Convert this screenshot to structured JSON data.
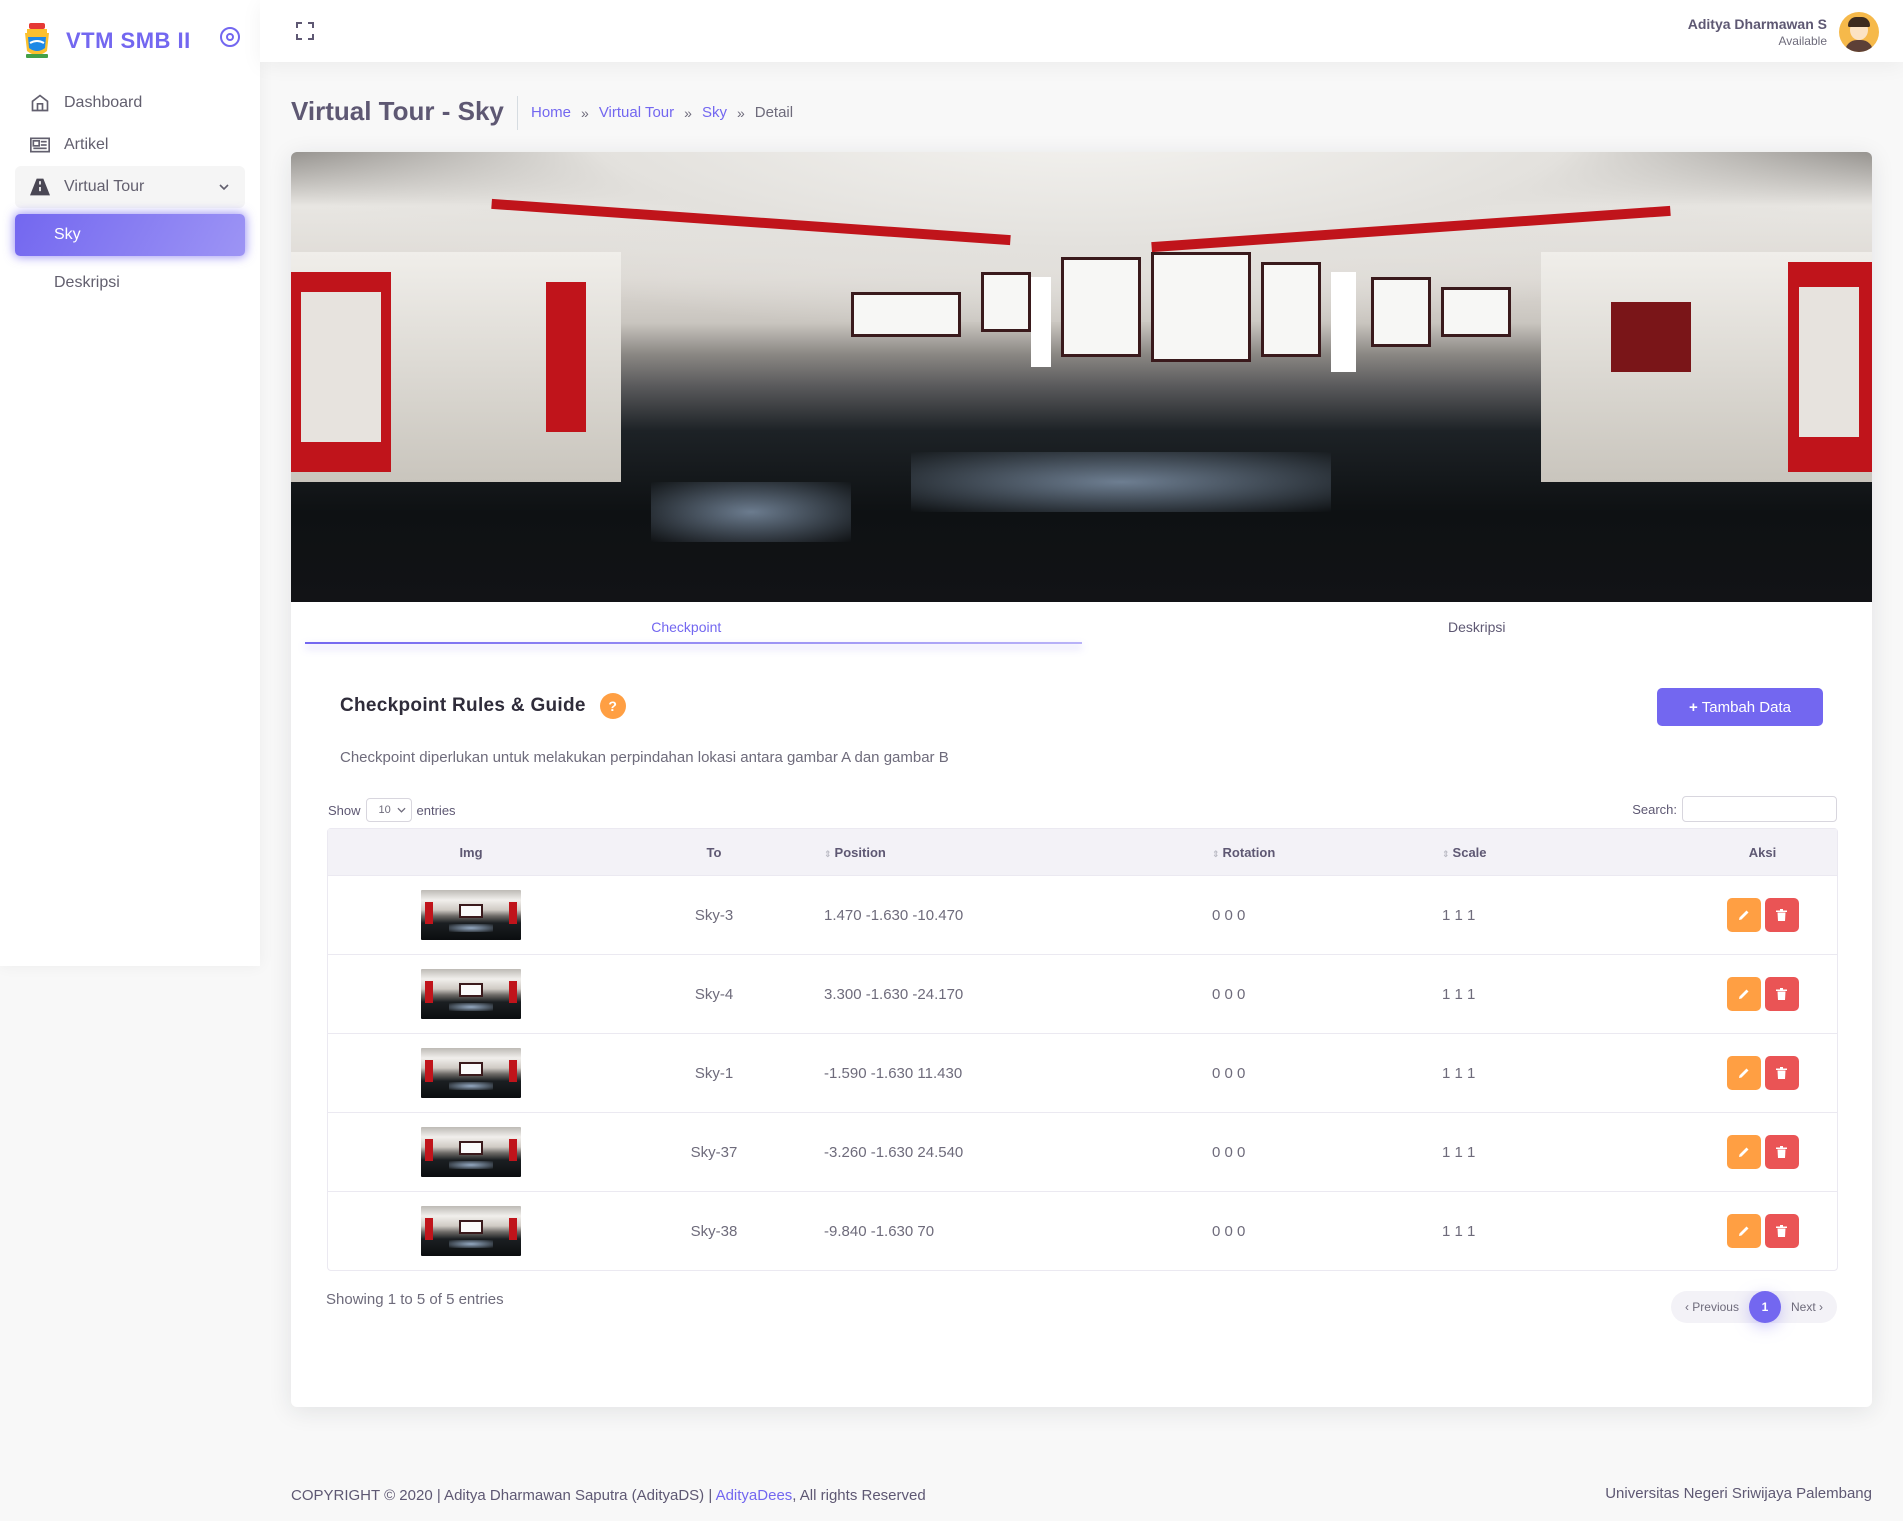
{
  "brand": {
    "name": "VTM SMB II"
  },
  "sidebar": {
    "items": [
      {
        "label": "Dashboard"
      },
      {
        "label": "Artikel"
      },
      {
        "label": "Virtual Tour"
      }
    ],
    "sub_items": [
      {
        "label": "Sky"
      },
      {
        "label": "Deskripsi"
      }
    ]
  },
  "topbar": {
    "user_name": "Aditya Dharmawan S",
    "user_status": "Available"
  },
  "header": {
    "title": "Virtual Tour - Sky",
    "breadcrumb": [
      "Home",
      "Virtual Tour",
      "Sky",
      "Detail"
    ],
    "separator": "»"
  },
  "tabs": [
    {
      "label": "Checkpoint"
    },
    {
      "label": "Deskripsi"
    }
  ],
  "guide": {
    "title": "Checkpoint Rules & Guide",
    "help": "?",
    "add_button": "Tambah Data",
    "description": "Checkpoint diperlukan untuk melakukan perpindahan lokasi antara gambar A dan gambar B"
  },
  "table_controls": {
    "show": "Show",
    "entries": "entries",
    "length_value": "10",
    "search_label": "Search:"
  },
  "table": {
    "headers": [
      "Img",
      "To",
      "Position",
      "Rotation",
      "Scale",
      "Aksi"
    ],
    "rows": [
      {
        "to": "Sky-3",
        "position": "1.470 -1.630 -10.470",
        "rotation": "0 0 0",
        "scale": "1 1 1"
      },
      {
        "to": "Sky-4",
        "position": "3.300 -1.630 -24.170",
        "rotation": "0 0 0",
        "scale": "1 1 1"
      },
      {
        "to": "Sky-1",
        "position": "-1.590 -1.630 11.430",
        "rotation": "0 0 0",
        "scale": "1 1 1"
      },
      {
        "to": "Sky-37",
        "position": "-3.260 -1.630 24.540",
        "rotation": "0 0 0",
        "scale": "1 1 1"
      },
      {
        "to": "Sky-38",
        "position": "-9.840 -1.630 70",
        "rotation": "0 0 0",
        "scale": "1 1 1"
      }
    ]
  },
  "pagination": {
    "info": "Showing 1 to 5 of 5 entries",
    "previous": "‹ Previous",
    "page": "1",
    "next": "Next ›"
  },
  "footer": {
    "copyright": "COPYRIGHT © 2020 | Aditya Dharmawan Saputra (AdityaDS) | ",
    "link": "AdityaDees",
    "rights": ", All rights Reserved",
    "right_text": "Universitas Negeri Sriwijaya Palembang"
  },
  "colors": {
    "primary": "#7367f0",
    "warning": "#ff9f43",
    "danger": "#ea5455"
  },
  "icons": [
    "fullscreen-icon",
    "home-icon",
    "newspaper-icon",
    "road-icon",
    "chevron-down-icon",
    "disc-icon",
    "pencil-icon",
    "trash-icon",
    "plus-icon"
  ]
}
